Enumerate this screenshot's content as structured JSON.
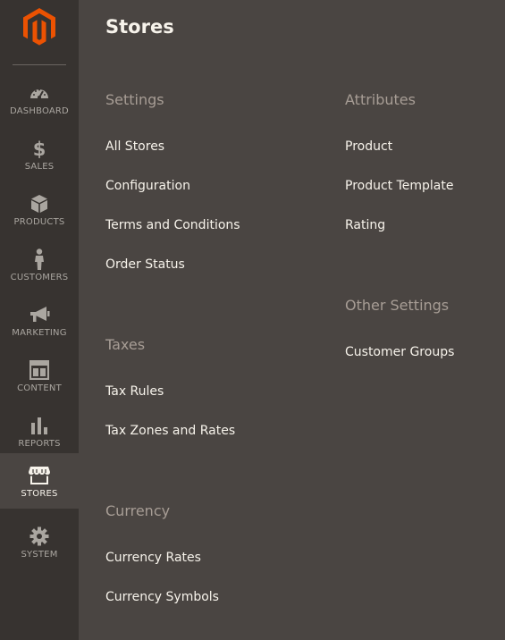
{
  "colors": {
    "sidebar_bg": "#373330",
    "panel_bg": "#4a4542",
    "brand_orange": "#eb5202",
    "icon_default": "#aaa6a0",
    "icon_active": "#f7f3eb",
    "section_title": "#a79d95",
    "link_text": "#f7f3eb"
  },
  "sidebar": {
    "logo_icon": "magento-logo-icon",
    "items": [
      {
        "label": "DASHBOARD",
        "icon": "dashboard-gauge-icon",
        "active": false
      },
      {
        "label": "SALES",
        "icon": "dollar-icon",
        "active": false
      },
      {
        "label": "PRODUCTS",
        "icon": "box-icon",
        "active": false
      },
      {
        "label": "CUSTOMERS",
        "icon": "person-icon",
        "active": false
      },
      {
        "label": "MARKETING",
        "icon": "megaphone-icon",
        "active": false
      },
      {
        "label": "CONTENT",
        "icon": "layout-icon",
        "active": false
      },
      {
        "label": "REPORTS",
        "icon": "bar-chart-icon",
        "active": false
      },
      {
        "label": "STORES",
        "icon": "storefront-icon",
        "active": true
      },
      {
        "label": "SYSTEM",
        "icon": "gear-icon",
        "active": false
      }
    ]
  },
  "panel": {
    "title": "Stores",
    "settings": {
      "title": "Settings",
      "links": [
        "All Stores",
        "Configuration",
        "Terms and Conditions",
        "Order Status"
      ]
    },
    "taxes": {
      "title": "Taxes",
      "links": [
        "Tax Rules",
        "Tax Zones and Rates"
      ]
    },
    "currency": {
      "title": "Currency",
      "links": [
        "Currency Rates",
        "Currency Symbols"
      ]
    },
    "attributes": {
      "title": "Attributes",
      "links": [
        "Product",
        "Product Template",
        "Rating"
      ]
    },
    "other_settings": {
      "title": "Other Settings",
      "links": [
        "Customer Groups"
      ]
    }
  }
}
